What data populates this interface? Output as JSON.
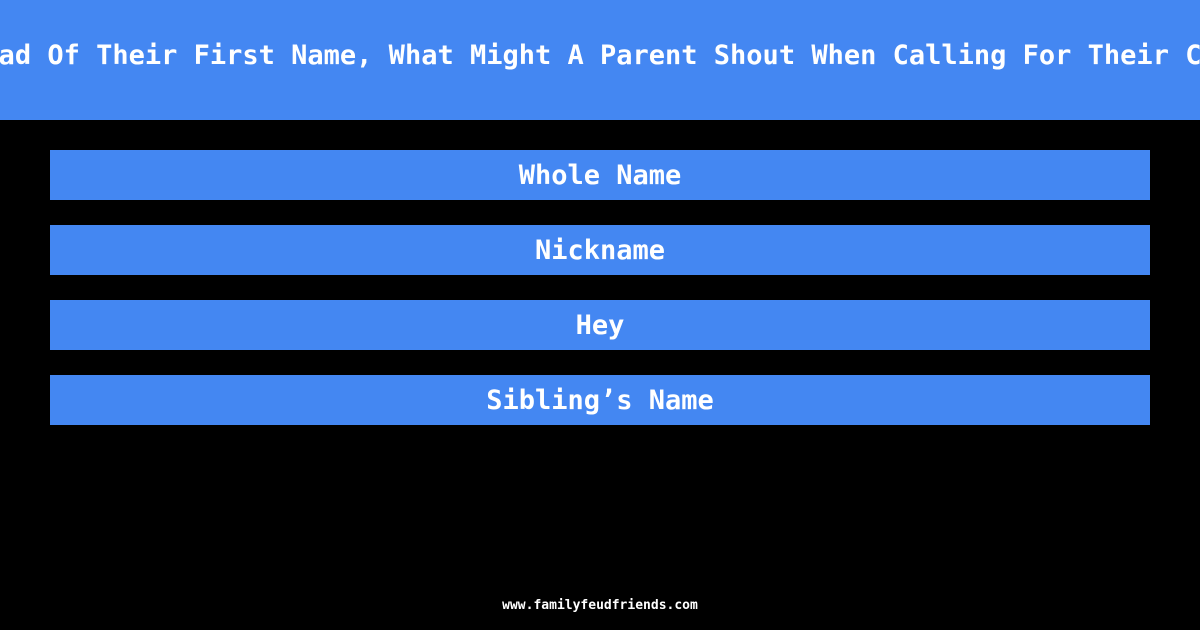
{
  "question": "Instead Of Their First Name, What Might A Parent Shout When Calling For Their Child?",
  "answers": [
    {
      "label": "Whole Name"
    },
    {
      "label": "Nickname"
    },
    {
      "label": "Hey"
    },
    {
      "label": "Sibling’s Name"
    }
  ],
  "footer": {
    "site": "www.familyfeudfriends.com"
  },
  "colors": {
    "accent": "#4487f2",
    "background": "#000000",
    "text": "#ffffff"
  }
}
